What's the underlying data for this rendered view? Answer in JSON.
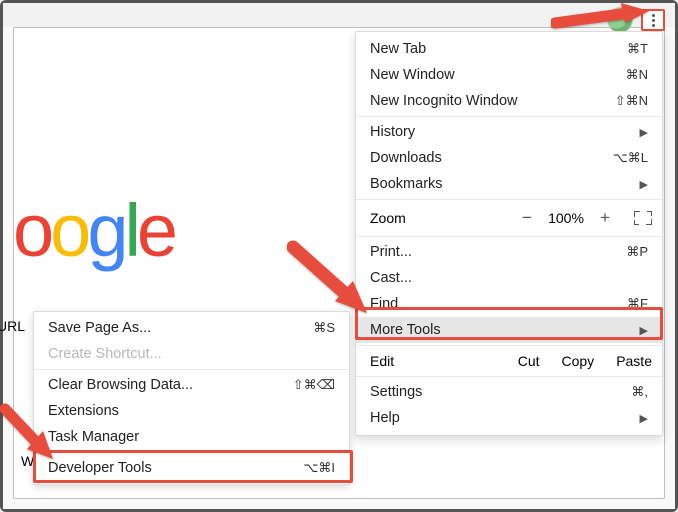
{
  "page": {
    "url_fragment": "URL",
    "w_fragment": "W",
    "logo_text": "oogle",
    "logo_colors": {
      "o1": "#ea4335",
      "o2": "#fbbc05",
      "g": "#4285f4",
      "l": "#34a853",
      "e": "#ea4335"
    }
  },
  "main_menu": {
    "sections": [
      [
        {
          "label": "New Tab",
          "shortcut": "⌘T"
        },
        {
          "label": "New Window",
          "shortcut": "⌘N"
        },
        {
          "label": "New Incognito Window",
          "shortcut": "⇧⌘N"
        }
      ],
      [
        {
          "label": "History",
          "chevron": true
        },
        {
          "label": "Downloads",
          "shortcut": "⌥⌘L"
        },
        {
          "label": "Bookmarks",
          "chevron": true
        }
      ]
    ],
    "zoom": {
      "label": "Zoom",
      "value": "100%"
    },
    "sections2": [
      [
        {
          "label": "Print...",
          "shortcut": "⌘P"
        },
        {
          "label": "Cast..."
        },
        {
          "label": "Find",
          "shortcut": "⌘F"
        },
        {
          "label": "More Tools",
          "chevron": true,
          "highlight": true
        }
      ]
    ],
    "edit": {
      "label": "Edit",
      "buttons": [
        "Cut",
        "Copy",
        "Paste"
      ]
    },
    "sections3": [
      [
        {
          "label": "Settings",
          "shortcut": "⌘,"
        },
        {
          "label": "Help",
          "chevron": true
        }
      ]
    ]
  },
  "submenu": {
    "items": [
      {
        "label": "Save Page As...",
        "shortcut": "⌘S"
      },
      {
        "label": "Create Shortcut...",
        "disabled": true
      },
      "sep",
      {
        "label": "Clear Browsing Data...",
        "shortcut": "⇧⌘⌫"
      },
      {
        "label": "Extensions"
      },
      {
        "label": "Task Manager"
      },
      "sep",
      {
        "label": "Developer Tools",
        "shortcut": "⌥⌘I",
        "highlight": true
      }
    ]
  }
}
